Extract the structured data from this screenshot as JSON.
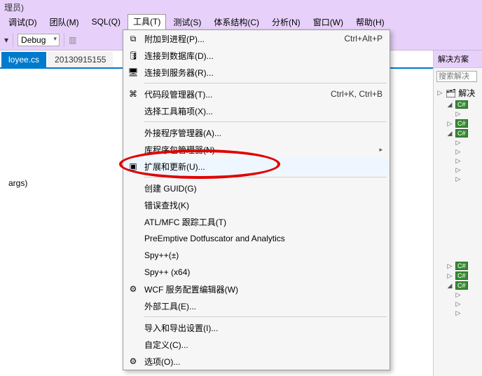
{
  "title": "理员)",
  "menubar": {
    "debug": "调试(D)",
    "team": "团队(M)",
    "sql": "SQL(Q)",
    "tools": "工具(T)",
    "test": "测试(S)",
    "arch": "体系结构(C)",
    "analyze": "分析(N)",
    "window": "窗口(W)",
    "help": "帮助(H)"
  },
  "toolbar": {
    "config": "Debug"
  },
  "tabs": {
    "active": "loyee.cs",
    "other": "20130915155"
  },
  "editor": {
    "line1": "args)"
  },
  "solution": {
    "title": "解决方案",
    "search": "搜索解决",
    "item_sol": "解决"
  },
  "menu": {
    "attach": "附加到进程(P)...",
    "attach_sc": "Ctrl+Alt+P",
    "db": "连接到数据库(D)...",
    "server": "连接到服务器(R)...",
    "codesnip": "代码段管理器(T)...",
    "codesnip_sc": "Ctrl+K, Ctrl+B",
    "toolbox": "选择工具箱项(X)...",
    "addin": "外接程序管理器(A)...",
    "libpkg": "库程序包管理器(N)",
    "ext": "扩展和更新(U)...",
    "guid": "创建 GUID(G)",
    "errlookup": "错误查找(K)",
    "atlmfc": "ATL/MFC 跟踪工具(T)",
    "preemptive": "PreEmptive Dotfuscator and Analytics",
    "spypp": "Spy++(±)",
    "spypp64": "Spy++ (x64)",
    "wcf": "WCF 服务配置编辑器(W)",
    "external": "外部工具(E)...",
    "impexp": "导入和导出设置(I)...",
    "customize": "自定义(C)...",
    "options": "选项(O)..."
  }
}
